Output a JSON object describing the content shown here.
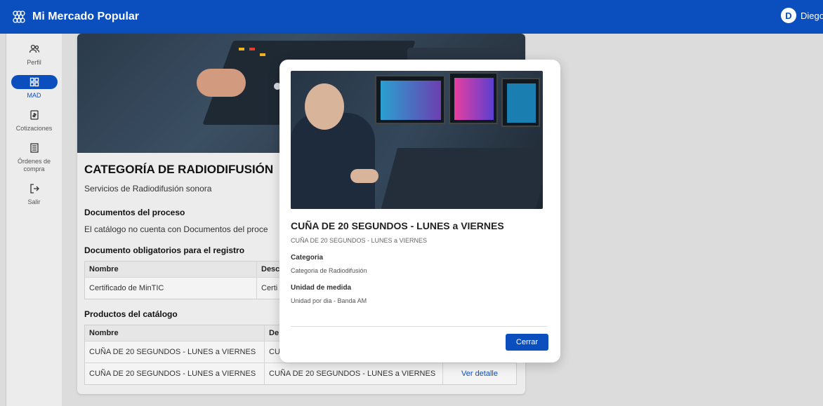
{
  "header": {
    "brand_name": "Mi Mercado Popular",
    "user_initial": "D",
    "user_name": "Diego"
  },
  "colors": {
    "primary": "#0b4fbf"
  },
  "sidebar": {
    "items": [
      {
        "label": "Perfil",
        "icon": "user-group-icon"
      },
      {
        "label": "MAD",
        "icon": "grid-icon",
        "active": true
      },
      {
        "label": "Cotizaciones",
        "icon": "document-icon"
      },
      {
        "label": "Órdenes de compra",
        "icon": "list-icon"
      },
      {
        "label": "Salir",
        "icon": "logout-icon"
      }
    ]
  },
  "page": {
    "category_title": "CATEGORÍA DE RADIODIFUSIÓN",
    "category_subtitle": "Servicios de Radiodifusión sonora",
    "documents_title": "Documentos del proceso",
    "documents_text": "El catálogo no cuenta con Documentos del proce",
    "required_docs_title": "Documento obligatorios para el registro",
    "required_docs_table": {
      "headers": [
        "Nombre",
        "Desc"
      ],
      "rows": [
        [
          "Certificado de MinTIC",
          "Certi"
        ]
      ]
    },
    "products_title": "Productos del catálogo",
    "products_table": {
      "headers": [
        "Nombre",
        "De"
      ],
      "rows": [
        [
          "CUÑA DE 20 SEGUNDOS - LUNES a VIERNES",
          "CU",
          ""
        ],
        [
          "CUÑA DE 20 SEGUNDOS - LUNES a VIERNES",
          "CUÑA DE 20 SEGUNDOS - LUNES a VIERNES",
          "Ver detalle"
        ]
      ]
    }
  },
  "modal": {
    "title": "CUÑA DE 20 SEGUNDOS - LUNES a VIERNES",
    "subtitle": "CUÑA DE 20 SEGUNDOS - LUNES a VIERNES",
    "category_label": "Categoria",
    "category_value": "Categoria de Radiodifusión",
    "unit_label": "Unidad de medida",
    "unit_value": "Unidad por dia - Banda AM",
    "close_label": "Cerrar"
  }
}
